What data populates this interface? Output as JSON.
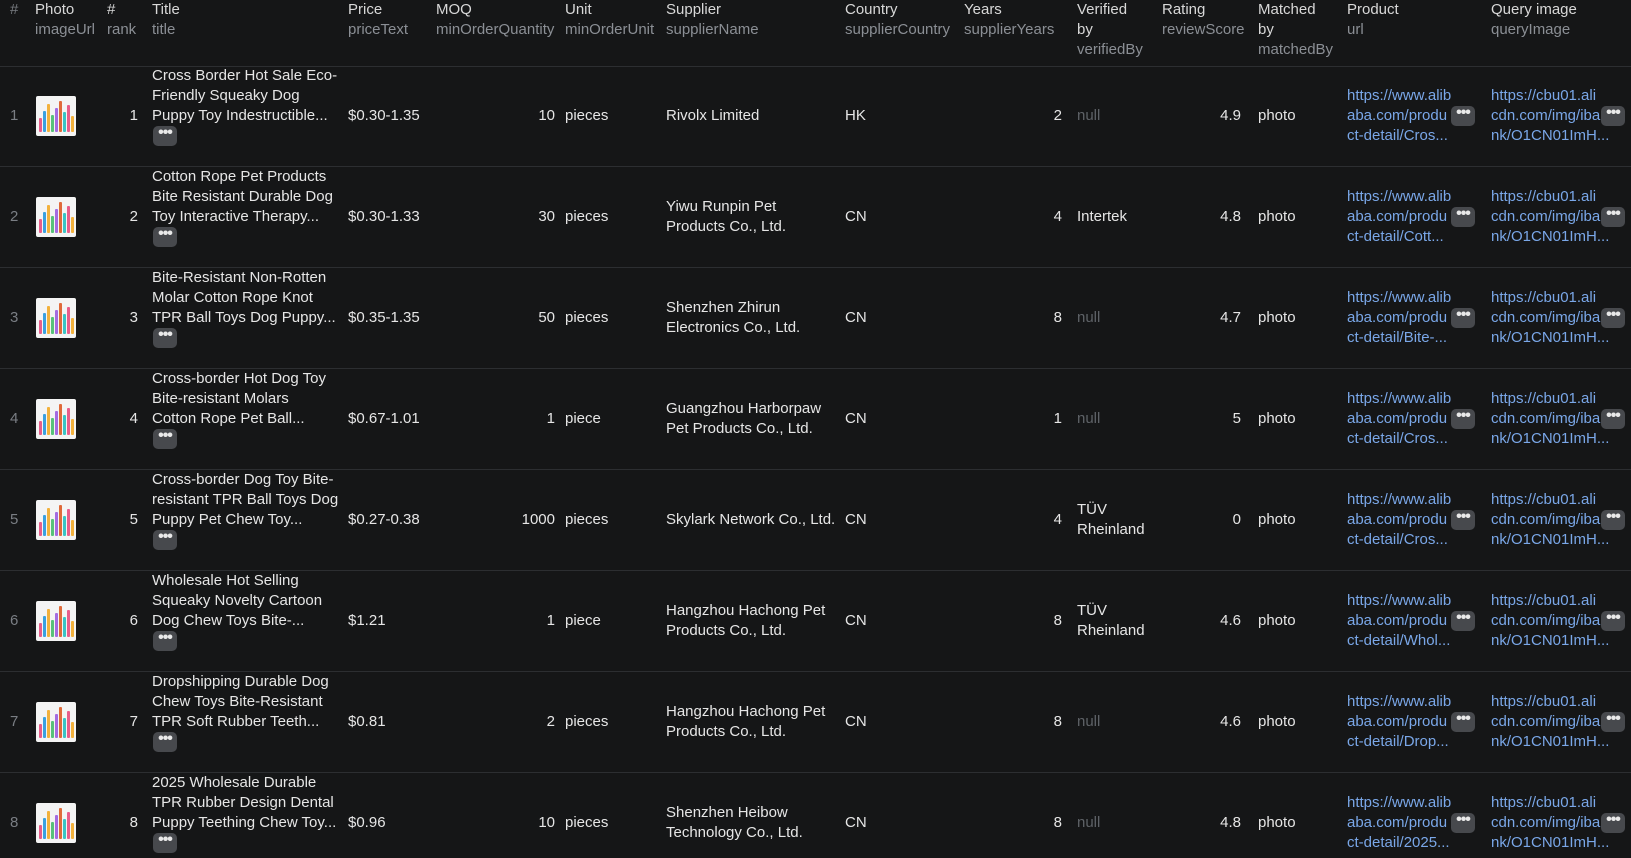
{
  "columns": [
    {
      "label": "#",
      "key": ""
    },
    {
      "label": "Photo",
      "key": "imageUrl"
    },
    {
      "label": "#",
      "key": "rank"
    },
    {
      "label": "Title",
      "key": "title"
    },
    {
      "label": "Price",
      "key": "priceText"
    },
    {
      "label": "MOQ",
      "key": "minOrderQuantity"
    },
    {
      "label": "Unit",
      "key": "minOrderUnit"
    },
    {
      "label": "Supplier",
      "key": "supplierName"
    },
    {
      "label": "Country",
      "key": "supplierCountry"
    },
    {
      "label": "Years",
      "key": "supplierYears"
    },
    {
      "label": "Verified",
      "label2": "by",
      "key": "verifiedBy"
    },
    {
      "label": "Rating",
      "key": "reviewScore"
    },
    {
      "label": "Matched",
      "label2": "by",
      "key": "matchedBy"
    },
    {
      "label": "Product",
      "key": "url"
    },
    {
      "label": "Query image",
      "key": "queryImage"
    }
  ],
  "more_glyph": "•••",
  "rows": [
    {
      "index": "1",
      "rank": "1",
      "title": [
        "Cross Border Hot Sale Eco-",
        "Friendly Squeaky Dog",
        "Puppy Toy Indestructible..."
      ],
      "price": "$0.30-1.35",
      "moq": "10",
      "unit": "pieces",
      "supplier": [
        "Rivolx Limited"
      ],
      "country": "HK",
      "years": "2",
      "verified": [
        "null"
      ],
      "verified_null": true,
      "rating": "4.9",
      "matched": "photo",
      "url": [
        "https://www.alib",
        "aba.com/produ",
        "ct-detail/Cros..."
      ],
      "query": [
        "https://cbu01.ali",
        "cdn.com/img/iba",
        "nk/O1CN01ImH..."
      ]
    },
    {
      "index": "2",
      "rank": "2",
      "title": [
        "Cotton Rope Pet Products",
        "Bite Resistant Durable Dog",
        "Toy Interactive Therapy..."
      ],
      "price": "$0.30-1.33",
      "moq": "30",
      "unit": "pieces",
      "supplier": [
        "Yiwu Runpin Pet",
        "Products Co., Ltd."
      ],
      "country": "CN",
      "years": "4",
      "verified": [
        "Intertek"
      ],
      "verified_null": false,
      "rating": "4.8",
      "matched": "photo",
      "url": [
        "https://www.alib",
        "aba.com/produ",
        "ct-detail/Cott..."
      ],
      "query": [
        "https://cbu01.ali",
        "cdn.com/img/iba",
        "nk/O1CN01ImH..."
      ]
    },
    {
      "index": "3",
      "rank": "3",
      "title": [
        "Bite-Resistant Non-Rotten",
        "Molar Cotton Rope Knot",
        "TPR Ball Toys Dog Puppy..."
      ],
      "price": "$0.35-1.35",
      "moq": "50",
      "unit": "pieces",
      "supplier": [
        "Shenzhen Zhirun",
        "Electronics Co., Ltd."
      ],
      "country": "CN",
      "years": "8",
      "verified": [
        "null"
      ],
      "verified_null": true,
      "rating": "4.7",
      "matched": "photo",
      "url": [
        "https://www.alib",
        "aba.com/produ",
        "ct-detail/Bite-..."
      ],
      "query": [
        "https://cbu01.ali",
        "cdn.com/img/iba",
        "nk/O1CN01ImH..."
      ]
    },
    {
      "index": "4",
      "rank": "4",
      "title": [
        "Cross-border Hot Dog Toy",
        "Bite-resistant Molars",
        "Cotton Rope Pet Ball..."
      ],
      "price": "$0.67-1.01",
      "moq": "1",
      "unit": "piece",
      "supplier": [
        "Guangzhou Harborpaw",
        "Pet Products Co., Ltd."
      ],
      "country": "CN",
      "years": "1",
      "verified": [
        "null"
      ],
      "verified_null": true,
      "rating": "5",
      "matched": "photo",
      "url": [
        "https://www.alib",
        "aba.com/produ",
        "ct-detail/Cros..."
      ],
      "query": [
        "https://cbu01.ali",
        "cdn.com/img/iba",
        "nk/O1CN01ImH..."
      ]
    },
    {
      "index": "5",
      "rank": "5",
      "title": [
        "Cross-border Dog Toy Bite-",
        "resistant TPR Ball Toys Dog",
        "Puppy Pet Chew Toy..."
      ],
      "price": "$0.27-0.38",
      "moq": "1000",
      "unit": "pieces",
      "supplier": [
        "Skylark Network Co., Ltd."
      ],
      "country": "CN",
      "years": "4",
      "verified": [
        "TÜV",
        "Rheinland"
      ],
      "verified_null": false,
      "rating": "0",
      "matched": "photo",
      "url": [
        "https://www.alib",
        "aba.com/produ",
        "ct-detail/Cros..."
      ],
      "query": [
        "https://cbu01.ali",
        "cdn.com/img/iba",
        "nk/O1CN01ImH..."
      ]
    },
    {
      "index": "6",
      "rank": "6",
      "title": [
        "Wholesale Hot Selling",
        "Squeaky Novelty Cartoon",
        "Dog Chew Toys Bite-..."
      ],
      "price": "$1.21",
      "moq": "1",
      "unit": "piece",
      "supplier": [
        "Hangzhou Hachong Pet",
        "Products Co., Ltd."
      ],
      "country": "CN",
      "years": "8",
      "verified": [
        "TÜV",
        "Rheinland"
      ],
      "verified_null": false,
      "rating": "4.6",
      "matched": "photo",
      "url": [
        "https://www.alib",
        "aba.com/produ",
        "ct-detail/Whol..."
      ],
      "query": [
        "https://cbu01.ali",
        "cdn.com/img/iba",
        "nk/O1CN01ImH..."
      ]
    },
    {
      "index": "7",
      "rank": "7",
      "title": [
        "Dropshipping Durable Dog",
        "Chew Toys Bite-Resistant",
        "TPR Soft Rubber Teeth..."
      ],
      "price": "$0.81",
      "moq": "2",
      "unit": "pieces",
      "supplier": [
        "Hangzhou Hachong Pet",
        "Products Co., Ltd."
      ],
      "country": "CN",
      "years": "8",
      "verified": [
        "null"
      ],
      "verified_null": true,
      "rating": "4.6",
      "matched": "photo",
      "url": [
        "https://www.alib",
        "aba.com/produ",
        "ct-detail/Drop..."
      ],
      "query": [
        "https://cbu01.ali",
        "cdn.com/img/iba",
        "nk/O1CN01ImH..."
      ]
    },
    {
      "index": "8",
      "rank": "8",
      "title": [
        "2025 Wholesale Durable",
        "TPR Rubber Design Dental",
        "Puppy Teething Chew Toy..."
      ],
      "price": "$0.96",
      "moq": "10",
      "unit": "pieces",
      "supplier": [
        "Shenzhen Heibow",
        "Technology Co., Ltd."
      ],
      "country": "CN",
      "years": "8",
      "verified": [
        "null"
      ],
      "verified_null": true,
      "rating": "4.8",
      "matched": "photo",
      "url": [
        "https://www.alib",
        "aba.com/produ",
        "ct-detail/2025..."
      ],
      "query": [
        "https://cbu01.ali",
        "cdn.com/img/iba",
        "nk/O1CN01ImH..."
      ]
    }
  ]
}
